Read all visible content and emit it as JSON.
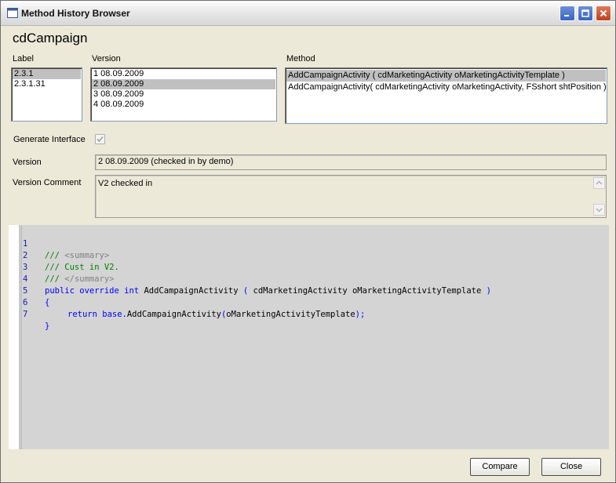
{
  "window": {
    "title": "Method History Browser"
  },
  "header": "cdCampaign",
  "labels": {
    "label": "Label",
    "version": "Version",
    "method": "Method",
    "generate_interface": "Generate Interface",
    "version_field": "Version",
    "version_comment": "Version Comment"
  },
  "label_list": [
    "2.3.1",
    "2.3.1.31"
  ],
  "version_list": [
    "1   08.09.2009",
    "2   08.09.2009",
    "3   08.09.2009",
    "4   08.09.2009"
  ],
  "method_list": [
    "AddCampaignActivity ( cdMarketingActivity oMarketingActivityTemplate )",
    "AddCampaignActivity( cdMarketingActivity oMarketingActivity, FSshort shtPosition )"
  ],
  "generate_interface_checked": true,
  "version_value": "2   08.09.2009 (checked in by demo)",
  "version_comment_value": "V2 checked in",
  "code": {
    "line_numbers": [
      "1",
      "2",
      "3",
      "4",
      "5",
      "6",
      "7"
    ],
    "l1_a": "/// ",
    "l1_b": "<summary>",
    "l2": "/// Cust in V2.",
    "l3_a": "/// ",
    "l3_b": "</summary>",
    "l4_a": "public override int ",
    "l4_b": "AddCampaignActivity ",
    "l4_c": "( ",
    "l4_d": "cdMarketingActivity oMarketingActivityTemplate ",
    "l4_e": ")",
    "l5": "{",
    "l6_a": "return base.",
    "l6_b": "AddCampaignActivity",
    "l6_c": "(",
    "l6_d": "oMarketingActivityTemplate",
    "l6_e": ");",
    "l7": "}"
  },
  "buttons": {
    "compare": "Compare",
    "close": "Close"
  },
  "colors": {
    "keyword": "#0000ff",
    "comment": "#008000",
    "xml_tag": "#808080",
    "selection": "#c0c0c0"
  }
}
